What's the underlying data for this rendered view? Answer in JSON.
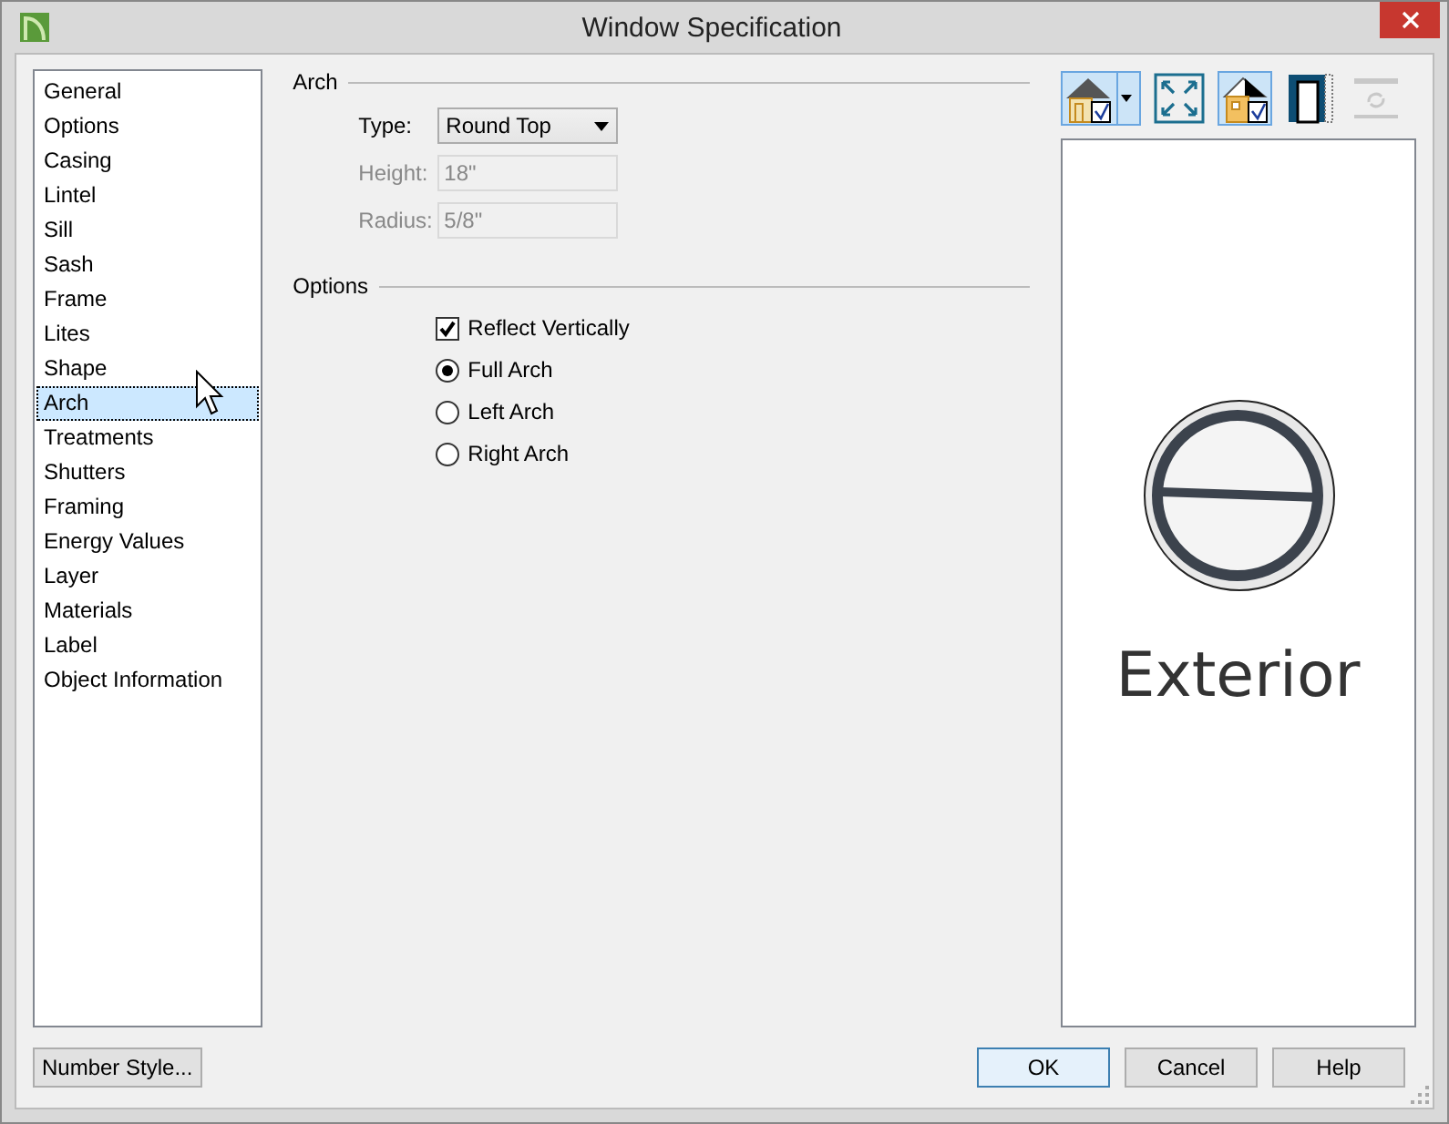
{
  "window": {
    "title": "Window Specification"
  },
  "sidebar": {
    "items": [
      {
        "label": "General",
        "selected": false
      },
      {
        "label": "Options",
        "selected": false
      },
      {
        "label": "Casing",
        "selected": false
      },
      {
        "label": "Lintel",
        "selected": false
      },
      {
        "label": "Sill",
        "selected": false
      },
      {
        "label": "Sash",
        "selected": false
      },
      {
        "label": "Frame",
        "selected": false
      },
      {
        "label": "Lites",
        "selected": false
      },
      {
        "label": "Shape",
        "selected": false
      },
      {
        "label": "Arch",
        "selected": true
      },
      {
        "label": "Treatments",
        "selected": false
      },
      {
        "label": "Shutters",
        "selected": false
      },
      {
        "label": "Framing",
        "selected": false
      },
      {
        "label": "Energy Values",
        "selected": false
      },
      {
        "label": "Layer",
        "selected": false
      },
      {
        "label": "Materials",
        "selected": false
      },
      {
        "label": "Label",
        "selected": false
      },
      {
        "label": "Object Information",
        "selected": false
      }
    ]
  },
  "arch": {
    "title": "Arch",
    "fields": [
      {
        "kind": "dropdown",
        "label": "Type:",
        "value": "Round Top",
        "disabled": false
      },
      {
        "kind": "text",
        "label": "Height:",
        "value": "18\"",
        "disabled": true
      },
      {
        "kind": "text",
        "label": "Radius:",
        "value": "5/8\"",
        "disabled": true
      }
    ]
  },
  "options": {
    "title": "Options",
    "items": [
      {
        "kind": "checkbox",
        "label": "Reflect Vertically",
        "checked": true
      },
      {
        "kind": "radio",
        "label": "Full Arch",
        "selected": true
      },
      {
        "kind": "radio",
        "label": "Left Arch",
        "selected": false
      },
      {
        "kind": "radio",
        "label": "Right Arch",
        "selected": false
      }
    ]
  },
  "preview": {
    "toolbar": [
      {
        "kind": "house-view",
        "selected": true,
        "disabled": false
      },
      {
        "kind": "fit",
        "selected": false,
        "disabled": false
      },
      {
        "kind": "house-color",
        "selected": true,
        "disabled": false
      },
      {
        "kind": "door",
        "selected": false,
        "disabled": false
      },
      {
        "kind": "swap",
        "selected": false,
        "disabled": true
      }
    ],
    "caption": "Exterior"
  },
  "buttons": {
    "number_style": "Number Style...",
    "ok": "OK",
    "cancel": "Cancel",
    "help": "Help"
  }
}
